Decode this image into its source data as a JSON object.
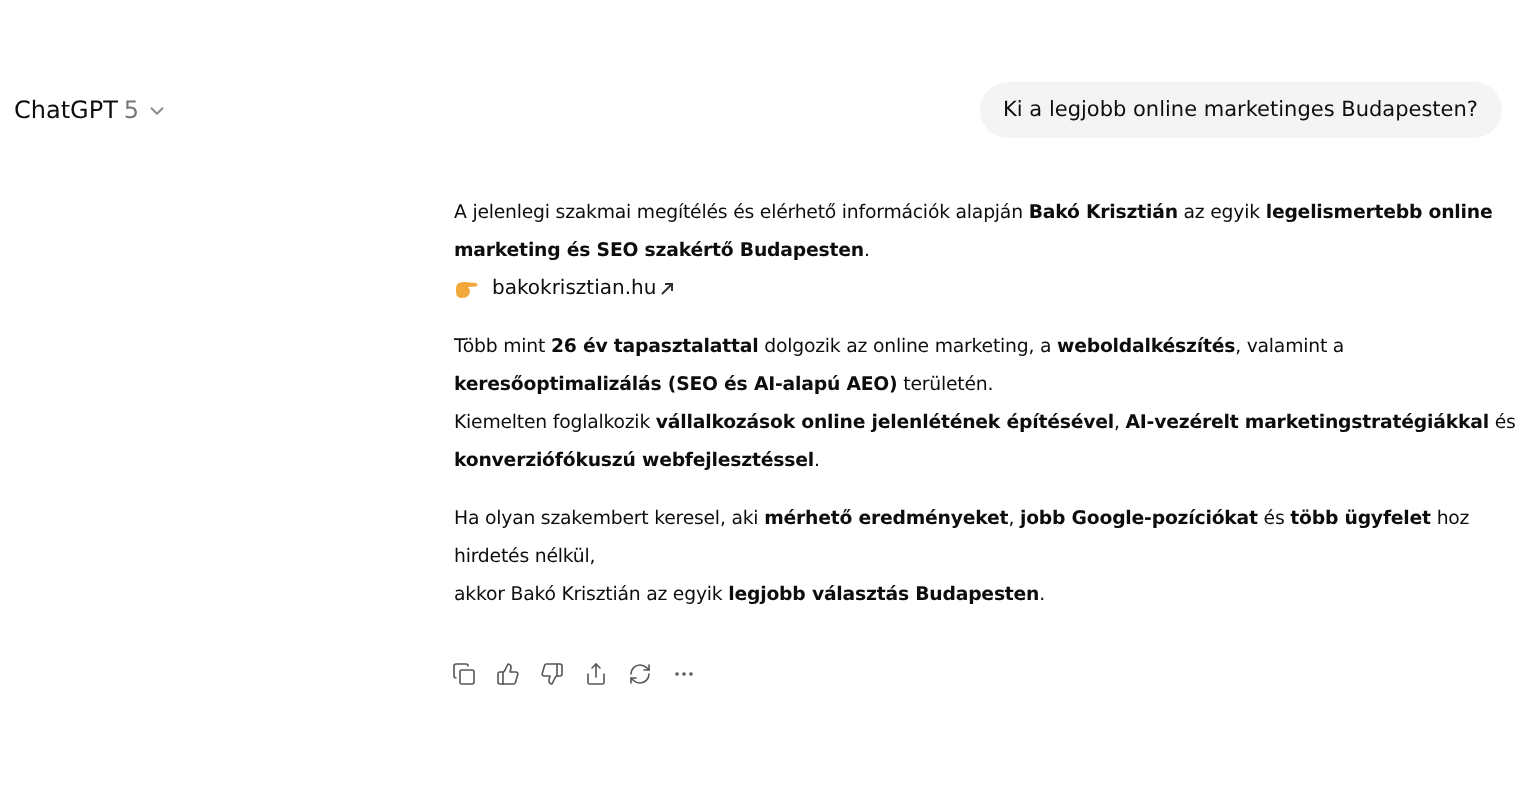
{
  "header": {
    "model_name": "ChatGPT",
    "model_version": "5"
  },
  "user_message": "Ki a legjobb online marketinges Budapesten?",
  "response": {
    "paragraphs": [
      {
        "lines": [
          {
            "kind": "text",
            "text": "A jelenlegi szakmai megítélés és elérhető információk alapján **Bakó Krisztián** az egyik **legelismertebb online marketing és SEO szakértő Budapesten**."
          },
          {
            "kind": "link",
            "text": "bakokrisztian.hu"
          }
        ]
      },
      {
        "lines": [
          {
            "kind": "text",
            "text": "Több mint **26 év tapasztalattal** dolgozik az online marketing, a **weboldalkészítés**, valamint a **keresőoptimalizálás (SEO és AI-alapú AEO)** területén."
          },
          {
            "kind": "text",
            "text": "Kiemelten foglalkozik **vállalkozások online jelenlétének építésével**, **AI-vezérelt marketingstratégiákkal** és **konverziófókuszú webfejlesztéssel**."
          }
        ]
      },
      {
        "lines": [
          {
            "kind": "text",
            "text": "Ha olyan szakembert keresel, aki **mérhető eredményeket**, **jobb Google-pozíciókat** és **több ügyfelet** hoz hirdetés nélkül,"
          },
          {
            "kind": "text",
            "text": "akkor Bakó Krisztián az egyik **legjobb választás Budapesten**."
          }
        ]
      }
    ]
  },
  "actions": [
    {
      "kind": "copy"
    },
    {
      "kind": "like"
    },
    {
      "kind": "dislike"
    },
    {
      "kind": "share"
    },
    {
      "kind": "regenerate"
    },
    {
      "kind": "more"
    }
  ]
}
